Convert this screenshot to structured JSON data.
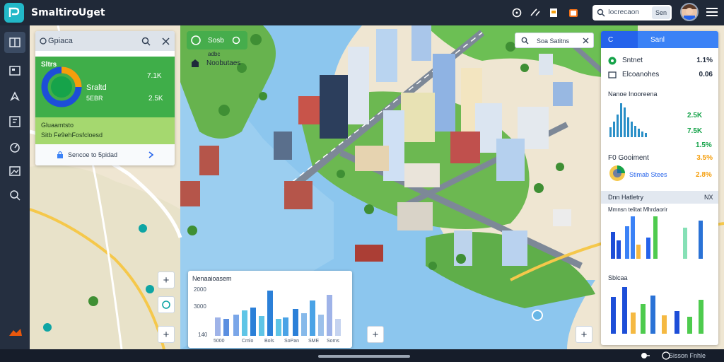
{
  "app": {
    "title": "SmaltiroUget"
  },
  "header": {
    "icons": [
      "help-icon",
      "tools-icon",
      "document-icon",
      "gift-icon"
    ],
    "search": {
      "placeholder": "Iocrecaon",
      "button_label": "Sen"
    }
  },
  "rail": {
    "items": [
      "book-icon",
      "image-icon",
      "compass-icon",
      "dashboard-icon",
      "speed-icon",
      "gallery-icon",
      "inspect-icon"
    ]
  },
  "left_panel": {
    "title": "Gpiaca",
    "summary": {
      "header": "Sltrs",
      "label": "Sraltd",
      "sub": "5EBR",
      "value_1": "7.1K",
      "value_2": "2.5K",
      "donut": {
        "percent_green": 70,
        "percent_orange": 30,
        "colors": {
          "ring": "#1d4ed8",
          "inner": "#16a34a",
          "accent": "#f59e0b"
        }
      }
    },
    "section_label": "Gluaamtsto",
    "section_sub": "Sitb Fe9ehFosfcloesd",
    "row_label": "Sencoe to 5pidad"
  },
  "map": {
    "chip_label": "Sosb",
    "chip_sub": "adbc",
    "place_label": "Noobutaes",
    "search_label": "Soa Satitns",
    "zoom_in": "+",
    "zoom_out": "+"
  },
  "right_panel": {
    "tabs": [
      "C",
      "Sanl"
    ],
    "rows": [
      {
        "icon": "status-icon",
        "label": "Sntnet",
        "value": "1.1%"
      },
      {
        "icon": "list-icon",
        "label": "Elcoanohes",
        "value": "0.06"
      }
    ],
    "chart1_title": "Nanoe Inooreena",
    "chart1_values": [
      {
        "label": "2.5K",
        "color": "#16a34a"
      },
      {
        "label": "7.5K",
        "color": "#16a34a"
      },
      {
        "label": "1.5%",
        "color": "#16a34a"
      }
    ],
    "row_ficonent": {
      "label": "F0 Gooiment",
      "value": "3.5%"
    },
    "row_stimab": {
      "label": "Stimab Stees",
      "value": "2.8%"
    },
    "section2_title": "Dnn Hatletry",
    "section2_value": "NX",
    "chart2_title": "Mmnsn telitat Mhrdaorir",
    "chart3_title": "Sblcaa"
  },
  "chart_panel": {
    "title": "Nenaaioasem",
    "y_ticks": [
      "2000",
      "3000",
      "140"
    ],
    "x_ticks": [
      "5000",
      "Cmlo",
      "Bols",
      "SoPan",
      "SME",
      "Soms"
    ]
  },
  "bottom": {
    "label": "Sisson Fnhle"
  }
}
